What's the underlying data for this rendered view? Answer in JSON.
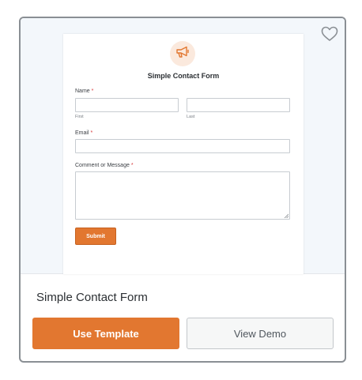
{
  "template": {
    "title": "Simple Contact Form",
    "use_label": "Use Template",
    "demo_label": "View Demo"
  },
  "preview": {
    "form_title": "Simple Contact Form",
    "name_label": "Name",
    "required_mark": "*",
    "first_sublabel": "First",
    "last_sublabel": "Last",
    "email_label": "Email",
    "message_label": "Comment or Message",
    "submit_label": "Submit"
  },
  "colors": {
    "accent": "#e27730",
    "badge_bg": "#fbe9dd",
    "preview_bg": "#f3f7fb",
    "required": "#d63638"
  },
  "icons": {
    "favorite": "heart-icon",
    "form_badge": "megaphone-icon"
  }
}
